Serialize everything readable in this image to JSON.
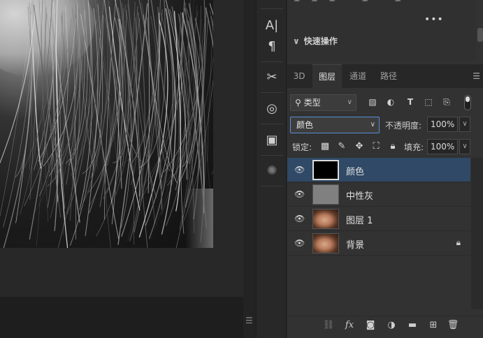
{
  "quick_actions": {
    "title": "快速操作"
  },
  "layers_panel": {
    "tabs": [
      {
        "label": "3D"
      },
      {
        "label": "图层"
      },
      {
        "label": "通道"
      },
      {
        "label": "路径"
      }
    ],
    "active_tab": "图层",
    "filter": {
      "label": "类型"
    },
    "blend_mode": "颜色",
    "opacity_label": "不透明度:",
    "opacity_value": "100%",
    "lock_label": "锁定:",
    "fill_label": "填充:",
    "fill_value": "100%",
    "layers": [
      {
        "name": "颜色",
        "thumb": "black",
        "selected": true,
        "locked": false
      },
      {
        "name": "中性灰",
        "thumb": "gray",
        "selected": false,
        "locked": false
      },
      {
        "name": "图层 1",
        "thumb": "face",
        "selected": false,
        "locked": false
      },
      {
        "name": "背景",
        "thumb": "face",
        "selected": false,
        "locked": true
      }
    ]
  },
  "toolbar": {
    "tools": [
      "character-panel-icon",
      "paragraph-panel-icon",
      "tool-presets-icon",
      "adjust-icon",
      "stamp-icon",
      "brightness-icon"
    ]
  },
  "colors": {
    "selection": "#2f4966",
    "panel_bg": "#323232",
    "focus_border": "#5a8dd6"
  }
}
